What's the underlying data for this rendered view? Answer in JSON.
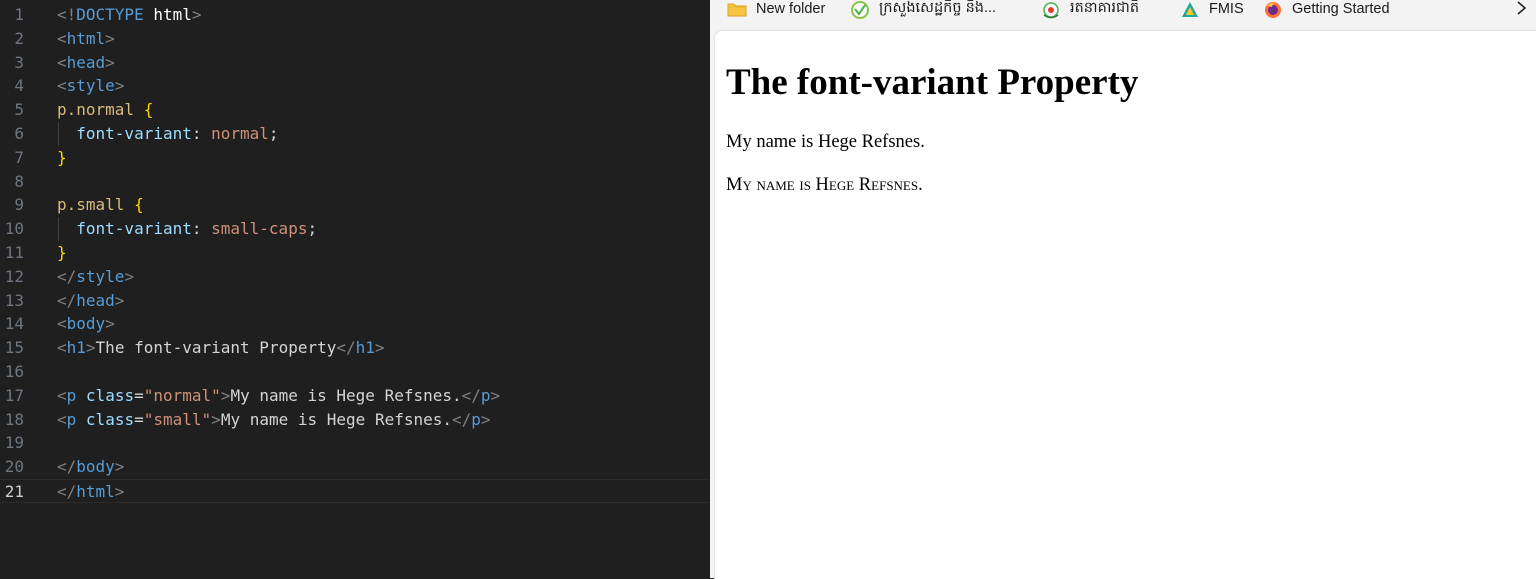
{
  "editor": {
    "lines": [
      {
        "n": "1",
        "tokens": [
          [
            "punct",
            "<!"
          ],
          [
            "doctype",
            "DOCTYPE"
          ],
          [
            "text",
            " "
          ],
          [
            "kw",
            "html"
          ],
          [
            "punct",
            ">"
          ]
        ]
      },
      {
        "n": "2",
        "tokens": [
          [
            "punct",
            "<"
          ],
          [
            "tag",
            "html"
          ],
          [
            "punct",
            ">"
          ]
        ]
      },
      {
        "n": "3",
        "tokens": [
          [
            "punct",
            "<"
          ],
          [
            "tag",
            "head"
          ],
          [
            "punct",
            ">"
          ]
        ]
      },
      {
        "n": "4",
        "tokens": [
          [
            "punct",
            "<"
          ],
          [
            "tag",
            "style"
          ],
          [
            "punct",
            ">"
          ]
        ]
      },
      {
        "n": "5",
        "tokens": [
          [
            "sel",
            "p.normal"
          ],
          [
            "text",
            " "
          ],
          [
            "brace",
            "{"
          ]
        ]
      },
      {
        "n": "6",
        "tokens": [
          [
            "text",
            "  "
          ],
          [
            "prop",
            "font-variant"
          ],
          [
            "text",
            ": "
          ],
          [
            "val",
            "normal"
          ],
          [
            "text",
            ";"
          ]
        ]
      },
      {
        "n": "7",
        "tokens": [
          [
            "brace",
            "}"
          ]
        ]
      },
      {
        "n": "8",
        "tokens": []
      },
      {
        "n": "9",
        "tokens": [
          [
            "sel",
            "p.small"
          ],
          [
            "text",
            " "
          ],
          [
            "brace",
            "{"
          ]
        ]
      },
      {
        "n": "10",
        "tokens": [
          [
            "text",
            "  "
          ],
          [
            "prop",
            "font-variant"
          ],
          [
            "text",
            ": "
          ],
          [
            "val",
            "small-caps"
          ],
          [
            "text",
            ";"
          ]
        ]
      },
      {
        "n": "11",
        "tokens": [
          [
            "brace",
            "}"
          ]
        ]
      },
      {
        "n": "12",
        "tokens": [
          [
            "punct",
            "</"
          ],
          [
            "tag",
            "style"
          ],
          [
            "punct",
            ">"
          ]
        ]
      },
      {
        "n": "13",
        "tokens": [
          [
            "punct",
            "</"
          ],
          [
            "tag",
            "head"
          ],
          [
            "punct",
            ">"
          ]
        ]
      },
      {
        "n": "14",
        "tokens": [
          [
            "punct",
            "<"
          ],
          [
            "tag",
            "body"
          ],
          [
            "punct",
            ">"
          ]
        ]
      },
      {
        "n": "15",
        "tokens": [
          [
            "punct",
            "<"
          ],
          [
            "tag",
            "h1"
          ],
          [
            "punct",
            ">"
          ],
          [
            "text",
            "The font-variant Property"
          ],
          [
            "punct",
            "</"
          ],
          [
            "tag",
            "h1"
          ],
          [
            "punct",
            ">"
          ]
        ]
      },
      {
        "n": "16",
        "tokens": []
      },
      {
        "n": "17",
        "tokens": [
          [
            "punct",
            "<"
          ],
          [
            "tag",
            "p"
          ],
          [
            "text",
            " "
          ],
          [
            "attr",
            "class"
          ],
          [
            "text",
            "="
          ],
          [
            "str",
            "\"normal\""
          ],
          [
            "punct",
            ">"
          ],
          [
            "text",
            "My name is Hege Refsnes."
          ],
          [
            "punct",
            "</"
          ],
          [
            "tag",
            "p"
          ],
          [
            "punct",
            ">"
          ]
        ]
      },
      {
        "n": "18",
        "tokens": [
          [
            "punct",
            "<"
          ],
          [
            "tag",
            "p"
          ],
          [
            "text",
            " "
          ],
          [
            "attr",
            "class"
          ],
          [
            "text",
            "="
          ],
          [
            "str",
            "\"small\""
          ],
          [
            "punct",
            ">"
          ],
          [
            "text",
            "My name is Hege Refsnes."
          ],
          [
            "punct",
            "</"
          ],
          [
            "tag",
            "p"
          ],
          [
            "punct",
            ">"
          ]
        ]
      },
      {
        "n": "19",
        "tokens": []
      },
      {
        "n": "20",
        "tokens": [
          [
            "punct",
            "</"
          ],
          [
            "tag",
            "body"
          ],
          [
            "punct",
            ">"
          ]
        ]
      },
      {
        "n": "21",
        "tokens": [
          [
            "punct",
            "</"
          ],
          [
            "tag",
            "html"
          ],
          [
            "punct",
            ">"
          ]
        ]
      }
    ],
    "current_line": "21"
  },
  "browser": {
    "bookmarks": [
      {
        "label": "New folder",
        "icon": "folder-icon"
      },
      {
        "label": "ក្រសួងសេដ្ឋកិច្ច និង...",
        "icon": "ministry-logo-icon"
      },
      {
        "label": "រតនាគារជាតិ",
        "icon": "treasury-logo-icon"
      },
      {
        "label": "FMIS",
        "icon": "fmis-logo-icon"
      },
      {
        "label": "Getting Started",
        "icon": "firefox-icon"
      }
    ],
    "more_icon": "chevron-right-icon",
    "page": {
      "heading": "The font-variant Property",
      "p_normal": "My name is Hege Refsnes.",
      "p_small": "My name is Hege Refsnes."
    }
  },
  "colors": {
    "editor_bg": "#1f1f1f",
    "tag": "#569cd6",
    "attr": "#9cdcfe",
    "string": "#ce9178",
    "selector": "#d7ba7d",
    "brace": "#ffd700",
    "page_bg": "#ffffff"
  }
}
